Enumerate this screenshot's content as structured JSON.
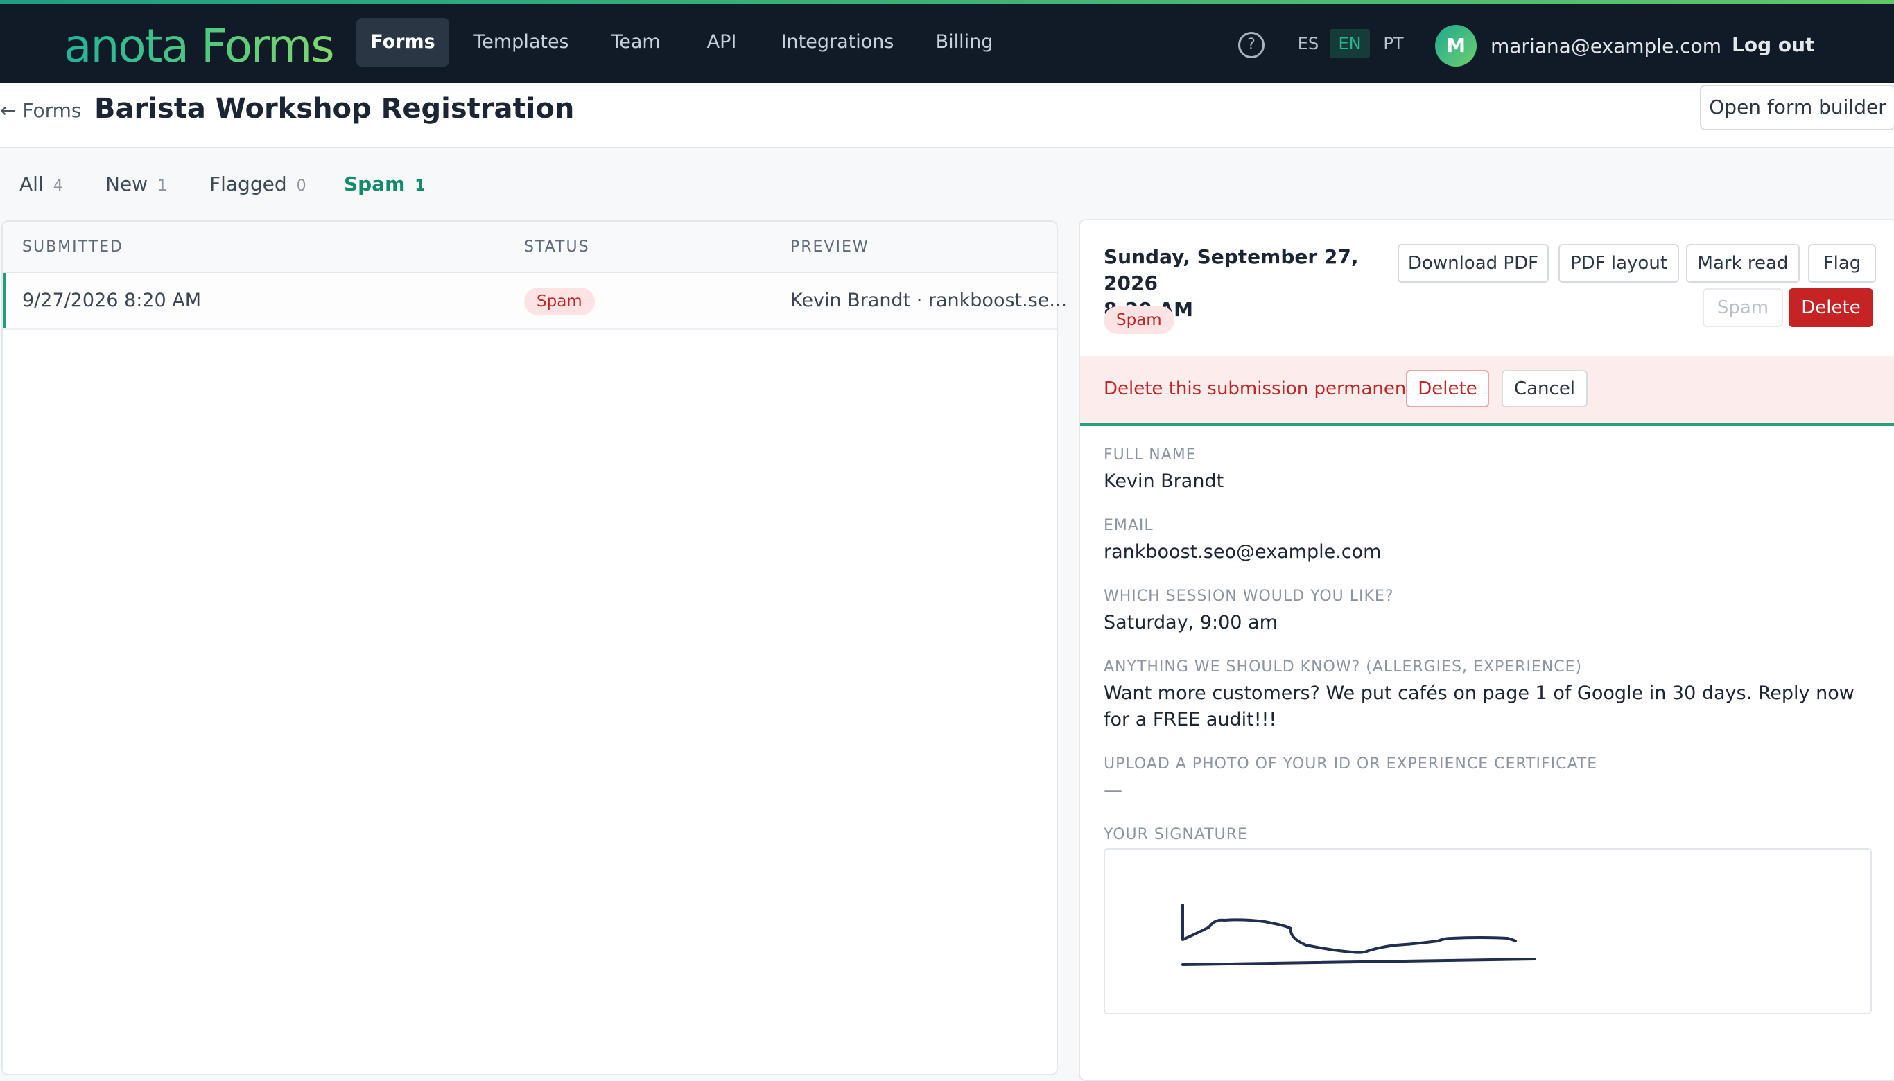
{
  "app": {
    "brand": "anota Forms",
    "nav": [
      "Forms",
      "Templates",
      "Team",
      "API",
      "Integrations",
      "Billing"
    ],
    "help_icon": "help-circle-icon",
    "languages": [
      "ES",
      "EN",
      "PT"
    ],
    "active_language": "EN",
    "user": {
      "initial": "M",
      "email": "mariana@example.com"
    },
    "logout": "Log out",
    "colors": {
      "accent": "#1f9e82",
      "danger": "#c62424",
      "topbar": "#111b27"
    }
  },
  "page": {
    "back_link": "← Forms",
    "title": "Barista Workshop Registration",
    "open_builder": "Open form builder"
  },
  "filters": [
    {
      "label": "All",
      "count": "4"
    },
    {
      "label": "New",
      "count": "1"
    },
    {
      "label": "Flagged",
      "count": "0"
    },
    {
      "label": "Spam",
      "count": "1",
      "active": true
    }
  ],
  "table": {
    "columns": [
      "SUBMITTED",
      "STATUS",
      "PREVIEW"
    ],
    "rows": [
      {
        "submitted": "9/27/2026 8:20 AM",
        "status": "Spam",
        "preview": "Kevin Brandt · rankboost.se..."
      }
    ]
  },
  "detail": {
    "date_line1": "Sunday, September 27, 2026",
    "date_line2": "8:20 AM",
    "status": "Spam",
    "actions": {
      "download_pdf": "Download PDF",
      "pdf_layout": "PDF layout",
      "mark_read": "Mark read",
      "flag": "Flag",
      "spam": "Spam",
      "delete": "Delete"
    },
    "confirm": {
      "text": "Delete this submission permanently?",
      "delete": "Delete",
      "cancel": "Cancel"
    },
    "fields": [
      {
        "label": "FULL NAME",
        "value": "Kevin Brandt"
      },
      {
        "label": "EMAIL",
        "value": "rankboost.seo@example.com"
      },
      {
        "label": "WHICH SESSION WOULD YOU LIKE?",
        "value": "Saturday, 9:00 am"
      },
      {
        "label": "ANYTHING WE SHOULD KNOW? (ALLERGIES, EXPERIENCE)",
        "value": "Want more customers? We put cafés on page 1 of Google in 30 days. Reply now for a FREE audit!!!"
      },
      {
        "label": "UPLOAD A PHOTO OF YOUR ID OR EXPERIENCE CERTIFICATE",
        "value": "—"
      },
      {
        "label": "YOUR SIGNATURE",
        "value": ""
      }
    ]
  }
}
